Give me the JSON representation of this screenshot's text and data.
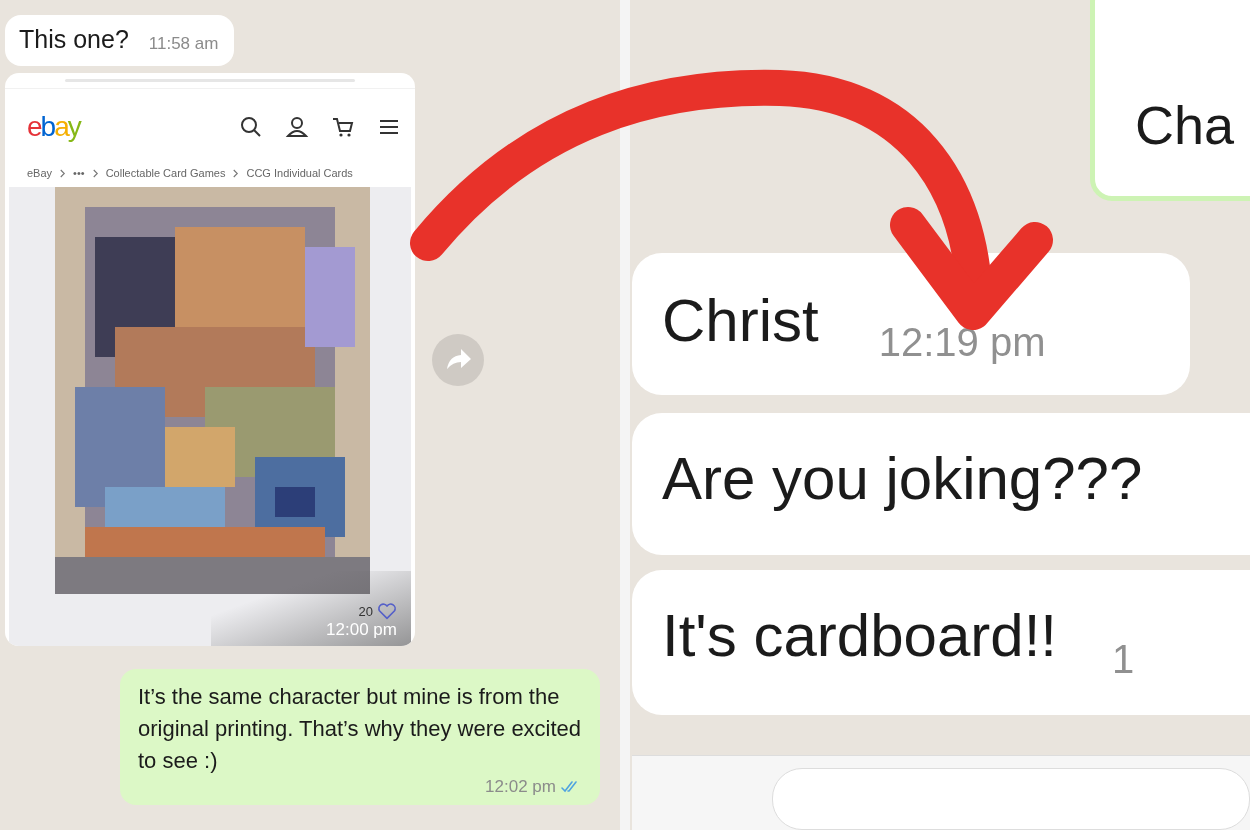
{
  "left_chat": {
    "messages": [
      {
        "kind": "text",
        "outgoing": false,
        "text": "This one?",
        "time": "11:58 am"
      },
      {
        "kind": "listing",
        "outgoing": false,
        "logo": "ebay",
        "breadcrumb": [
          "eBay",
          "•••",
          "Collectable Card Games",
          "CCG Individual Cards"
        ],
        "likes": "20",
        "liked": false,
        "time": "12:00 pm"
      },
      {
        "kind": "text",
        "outgoing": true,
        "text": "It’s the same character but mine is from the original printing. That’s why they were excited to see :)",
        "time": "12:02 pm",
        "read": true
      }
    ]
  },
  "right_chat": {
    "messages": [
      {
        "kind": "text",
        "outgoing": true,
        "text": "Cha"
      },
      {
        "kind": "text",
        "outgoing": false,
        "text": "Christ",
        "time": "12:19 pm"
      },
      {
        "kind": "text",
        "outgoing": false,
        "text": "Are you joking???"
      },
      {
        "kind": "text",
        "outgoing": false,
        "text": "It's cardboard!!",
        "time": "1"
      }
    ]
  }
}
